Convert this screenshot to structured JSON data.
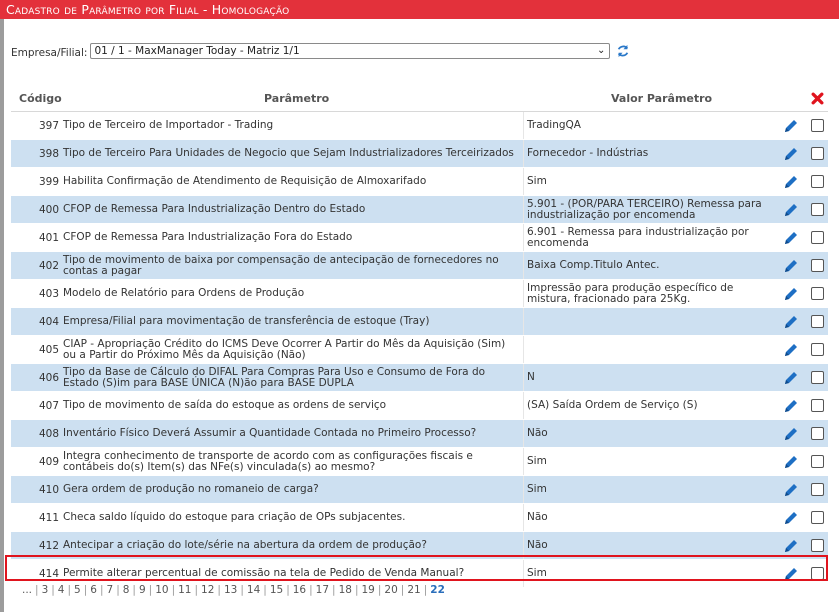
{
  "header": {
    "title": "Cadastro de Parâmetro por Filial   - Homologação"
  },
  "filter": {
    "label": "Empresa/Filial:",
    "value": "01 / 1 - MaxManager Today - Matriz 1/1"
  },
  "grid": {
    "columns": {
      "code": "Código",
      "param": "Parâmetro",
      "value": "Valor Parâmetro"
    },
    "rows": [
      {
        "code": "397",
        "param": "Tipo de Terceiro de Importador - Trading",
        "value": "TradingQA"
      },
      {
        "code": "398",
        "param": "Tipo de Terceiro Para Unidades de Negocio que Sejam Industrializadores Terceirizados",
        "value": "Fornecedor - Indústrias"
      },
      {
        "code": "399",
        "param": "Habilita Confirmação de Atendimento de Requisição de Almoxarifado",
        "value": "Sim"
      },
      {
        "code": "400",
        "param": "CFOP de Remessa Para Industrialização Dentro do Estado",
        "value": "5.901 - (POR/PARA TERCEIRO) Remessa para industrialização por encomenda"
      },
      {
        "code": "401",
        "param": "CFOP de Remessa Para Industrialização Fora do Estado",
        "value": "6.901 - Remessa para industrialização por encomenda"
      },
      {
        "code": "402",
        "param": "Tipo de movimento de baixa por compensação de antecipação de fornecedores no contas a pagar",
        "value": "Baixa Comp.Titulo Antec."
      },
      {
        "code": "403",
        "param": "Modelo de Relatório para Ordens de Produção",
        "value": "Impressão para produção específico de mistura, fracionado para 25Kg."
      },
      {
        "code": "404",
        "param": "Empresa/Filial para movimentação de transferência de estoque (Tray)",
        "value": ""
      },
      {
        "code": "405",
        "param": "CIAP - Apropriação Crédito do ICMS Deve Ocorrer A Partir do Mês da Aquisição (Sim) ou a Partir do Próximo Mês da Aquisição (Não)",
        "value": ""
      },
      {
        "code": "406",
        "param": "Tipo da Base de Cálculo do DIFAL Para Compras Para Uso e Consumo de Fora do Estado (S)im para BASE ÚNICA (N)ão para BASE DUPLA",
        "value": "N"
      },
      {
        "code": "407",
        "param": "Tipo de movimento de saída do estoque as ordens de serviço",
        "value": "(SA) Saída Ordem de Serviço (S)"
      },
      {
        "code": "408",
        "param": "Inventário Físico Deverá Assumir a Quantidade Contada no Primeiro Processo?",
        "value": "Não"
      },
      {
        "code": "409",
        "param": "Integra conhecimento de transporte de acordo com as configurações fiscais e contábeis do(s) Item(s) das NFe(s) vinculada(s) ao mesmo?",
        "value": "Sim"
      },
      {
        "code": "410",
        "param": "Gera ordem de produção no romaneio de carga?",
        "value": "Sim"
      },
      {
        "code": "411",
        "param": "Checa saldo líquido do estoque para criação de OPs subjacentes.",
        "value": "Não"
      },
      {
        "code": "412",
        "param": "Antecipar a criação do lote/série na abertura da ordem de produção?",
        "value": "Não"
      },
      {
        "code": "414",
        "param": "Permite alterar percentual de comissão na tela de Pedido de Venda Manual?",
        "value": "Sim"
      }
    ]
  },
  "pager": {
    "ellipsis": "...",
    "pages": [
      "3",
      "4",
      "5",
      "6",
      "7",
      "8",
      "9",
      "10",
      "11",
      "12",
      "13",
      "14",
      "15",
      "16",
      "17",
      "18",
      "19",
      "20",
      "21"
    ],
    "current": "22"
  },
  "icons": {
    "edit": "pencil-icon",
    "delete": "red-x-icon",
    "refresh": "refresh-icon"
  },
  "colors": {
    "title_bar": "#e3313b",
    "row_alt": "#cde0f1",
    "highlight_border": "#e0141e",
    "edit_icon": "#1e6fc4"
  }
}
